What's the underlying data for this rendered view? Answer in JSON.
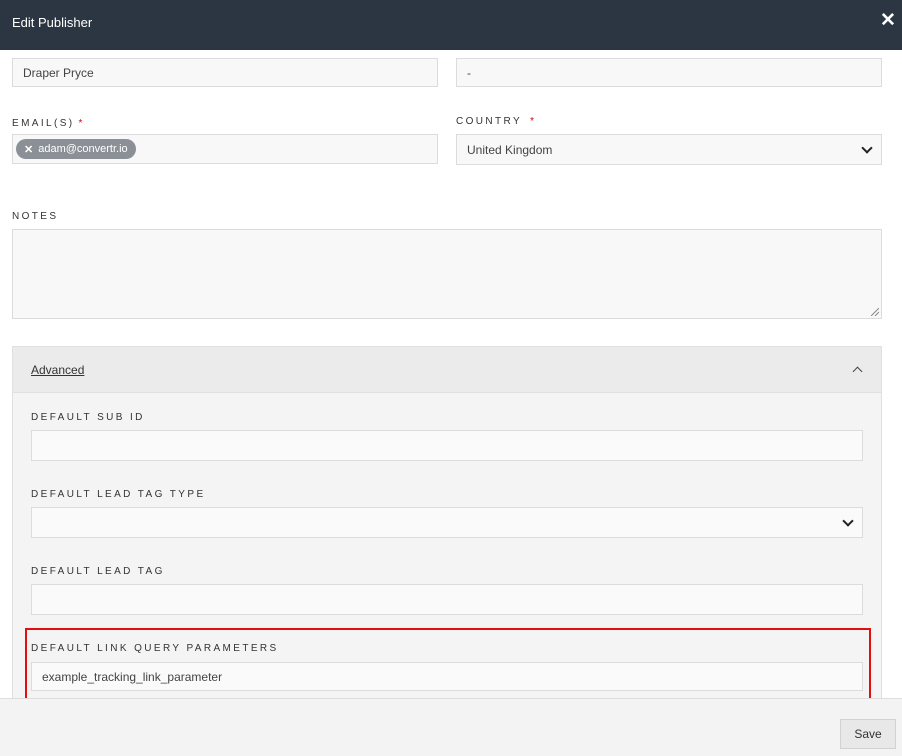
{
  "header": {
    "title": "Edit Publisher",
    "close_icon": "close-icon"
  },
  "form": {
    "name_value": "Draper Pryce",
    "second_value": "-",
    "emails_label": "EMAIL(S)",
    "emails_required": "*",
    "email_tags": [
      "adam@convertr.io"
    ],
    "tag_remove_glyph": "✕",
    "country_label": "COUNTRY",
    "country_required": "*",
    "country_value": "United Kingdom",
    "notes_label": "NOTES",
    "notes_value": ""
  },
  "advanced": {
    "title": "Advanced",
    "default_sub_id_label": "DEFAULT SUB ID",
    "default_sub_id_value": "",
    "default_lead_tag_type_label": "DEFAULT LEAD TAG TYPE",
    "default_lead_tag_type_value": "",
    "default_lead_tag_label": "DEFAULT LEAD TAG",
    "default_lead_tag_value": "",
    "default_link_query_parameters_label": "DEFAULT LINK QUERY PARAMETERS",
    "default_link_query_parameters_value": "example_tracking_link_parameter"
  },
  "footer": {
    "save_label": "Save"
  },
  "colors": {
    "header_bg": "#2c3643",
    "required": "#d0021b",
    "highlight": "#e01010",
    "tag_bg": "#8a9096"
  }
}
